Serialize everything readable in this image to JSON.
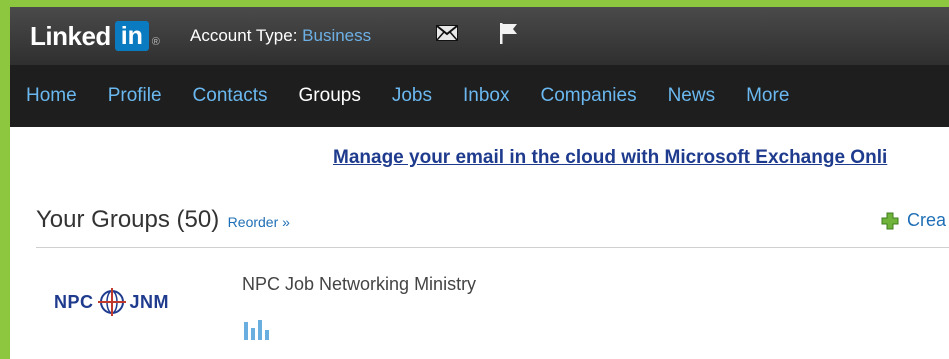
{
  "header": {
    "logo_text": "Linked",
    "logo_in": "in",
    "logo_reg": "®",
    "account_type_label": "Account Type:",
    "account_type_value": "Business",
    "icons": [
      "mail-icon",
      "flag-icon"
    ]
  },
  "nav": {
    "items": [
      {
        "label": "Home",
        "active": false
      },
      {
        "label": "Profile",
        "active": false
      },
      {
        "label": "Contacts",
        "active": false
      },
      {
        "label": "Groups",
        "active": true
      },
      {
        "label": "Jobs",
        "active": false
      },
      {
        "label": "Inbox",
        "active": false
      },
      {
        "label": "Companies",
        "active": false
      },
      {
        "label": "News",
        "active": false
      },
      {
        "label": "More",
        "active": false
      }
    ]
  },
  "promo": {
    "text": "Manage your email in the cloud with Microsoft Exchange Onli"
  },
  "groups": {
    "title": "Your Groups (50)",
    "reorder": "Reorder »",
    "create_label": "Crea",
    "items": [
      {
        "logo_left": "NPC",
        "logo_right": "JNM",
        "name": "NPC Job Networking Ministry"
      }
    ]
  },
  "colors": {
    "frame_green": "#8dc63f",
    "nav_link": "#6ab8ef",
    "promo_link": "#1f3b8e",
    "logo_blue": "#0b7bc1"
  }
}
